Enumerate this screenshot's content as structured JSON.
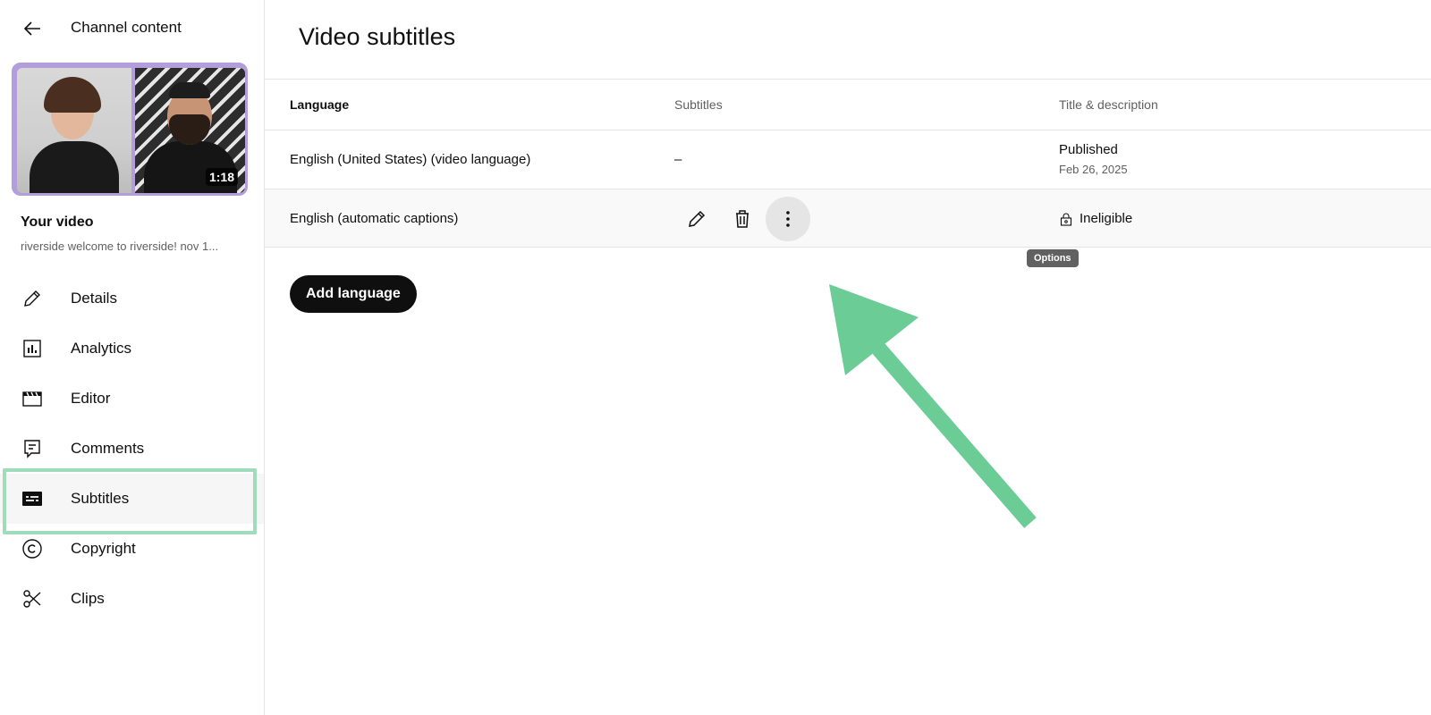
{
  "sidebar": {
    "header_title": "Channel content",
    "video_duration": "1:18",
    "your_video_label": "Your video",
    "video_name": "riverside welcome to riverside! nov 1...",
    "items": [
      {
        "label": "Details",
        "icon": "pencil-icon"
      },
      {
        "label": "Analytics",
        "icon": "analytics-icon"
      },
      {
        "label": "Editor",
        "icon": "clapperboard-icon"
      },
      {
        "label": "Comments",
        "icon": "comment-icon"
      },
      {
        "label": "Subtitles",
        "icon": "subtitles-icon",
        "active": true
      },
      {
        "label": "Copyright",
        "icon": "copyright-icon"
      },
      {
        "label": "Clips",
        "icon": "scissors-icon"
      }
    ]
  },
  "main": {
    "title": "Video subtitles",
    "table": {
      "headers": [
        "Language",
        "Subtitles",
        "Title & description"
      ],
      "rows": [
        {
          "language": "English (United States) (video language)",
          "subtitles": "–",
          "status": "Published",
          "date": "Feb 26, 2025"
        },
        {
          "language": "English (automatic captions)",
          "status": "Ineligible"
        }
      ]
    },
    "tooltip": "Options",
    "add_button": "Add language"
  },
  "colors": {
    "accent_highlight": "#9fdcbb",
    "arrow": "#6ccc96",
    "primary_button": "#0f0f0f"
  }
}
